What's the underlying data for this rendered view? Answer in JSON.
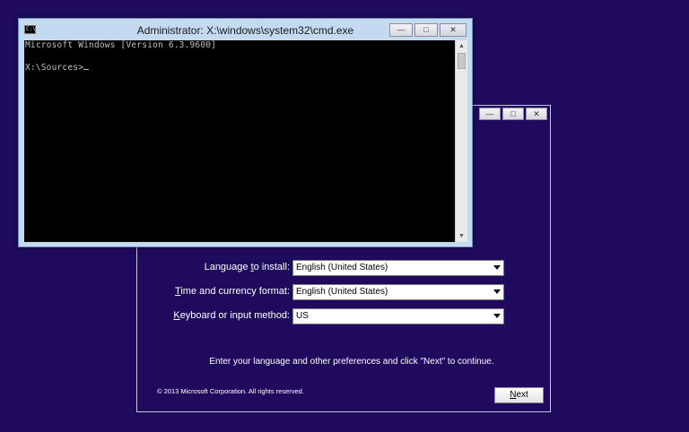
{
  "setup": {
    "fields": [
      {
        "label_pre": "Language ",
        "label_u": "t",
        "label_post": "o install:",
        "value": "English (United States)"
      },
      {
        "label_pre": "",
        "label_u": "T",
        "label_post": "ime and currency format:",
        "value": "English (United States)"
      },
      {
        "label_pre": "",
        "label_u": "K",
        "label_post": "eyboard or input method:",
        "value": "US"
      }
    ],
    "hint": "Enter your language and other preferences and click \"Next\" to continue.",
    "copyright": "© 2013 Microsoft Corporation. All rights reserved.",
    "next_u": "N",
    "next_rest": "ext"
  },
  "cmd": {
    "title": "Administrator: X:\\windows\\system32\\cmd.exe",
    "icon_text": "C:\\",
    "lines": [
      "Microsoft Windows [Version 6.3.9600]",
      "",
      "X:\\Sources>"
    ]
  },
  "icons": {
    "minimize": "minimize-icon",
    "maximize": "maximize-icon",
    "close": "close-icon",
    "dropdown": "chevron-down-icon"
  },
  "colors": {
    "background": "#1f0a5e",
    "console": "#000000",
    "console_text": "#c0c0c0",
    "titlebar": "#c3daf1"
  }
}
